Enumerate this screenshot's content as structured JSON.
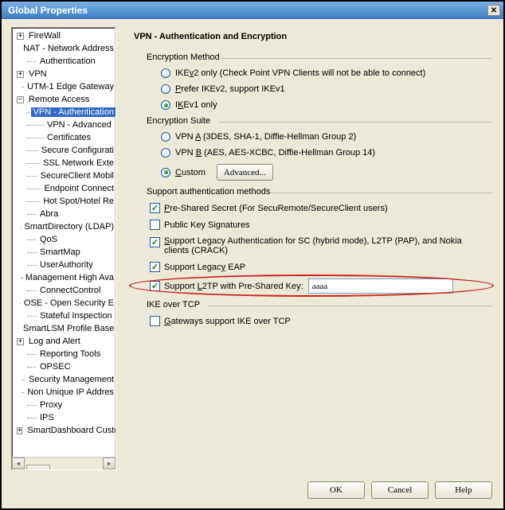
{
  "window": {
    "title": "Global Properties"
  },
  "tree": {
    "firewall": "FireWall",
    "nat": "NAT - Network Address",
    "auth": "Authentication",
    "vpn": "VPN",
    "utm": "UTM-1 Edge Gateway",
    "remote": "Remote Access",
    "vpnauth": "VPN - Authentication",
    "vpnadv": "VPN - Advanced",
    "certs": "Certificates",
    "secconf": "Secure Configurati",
    "sslnet": "SSL Network Exte",
    "scmobile": "SecureClient Mobil",
    "endpoint": "Endpoint Connect",
    "hotspot": "Hot Spot/Hotel Re",
    "abra": "Abra",
    "smartdir": "SmartDirectory (LDAP)",
    "qos": "QoS",
    "smartmap": "SmartMap",
    "userauth": "UserAuthority",
    "mgmtha": "Management High Ava",
    "conncontrol": "ConnectControl",
    "ose": "OSE - Open Security E",
    "stateful": "Stateful Inspection",
    "slsm": "SmartLSM Profile Base",
    "logalert": "Log and Alert",
    "reporting": "Reporting Tools",
    "opsec": "OPSEC",
    "secmgmt": "Security Management",
    "nonunique": "Non Unique IP Addres",
    "proxy": "Proxy",
    "ips": "IPS",
    "sdcusto": "SmartDashboard Custo"
  },
  "page": {
    "title": "VPN - Authentication and Encryption",
    "enc_method_title": "Encryption Method",
    "enc_suite_title": "Encryption Suite",
    "supp_title": "Support authentication methods",
    "ike_title": "IKE over TCP",
    "radio_ikev2only_pre": "IKE",
    "radio_ikev2only_u": "v",
    "radio_ikev2only_post": "2 only (Check Point VPN Clients will not be able to connect)",
    "radio_prefer_pre": "",
    "radio_prefer_u": "P",
    "radio_prefer_post": "refer IKEv2, support IKEv1",
    "radio_ikev1_pre": "I",
    "radio_ikev1_u": "K",
    "radio_ikev1_post": "Ev1 only",
    "radio_vpna_pre": "VPN ",
    "radio_vpna_u": "A",
    "radio_vpna_post": " (3DES, SHA-1, Diffie-Hellman Group 2)",
    "radio_vpnb_pre": "VPN ",
    "radio_vpnb_u": "B",
    "radio_vpnb_post": " (AES, AES-XCBC, Diffie-Hellman Group 14)",
    "radio_custom_u": "C",
    "radio_custom_post": "ustom",
    "btn_advanced": "Advanced...",
    "chk_pss_u": "P",
    "chk_pss_post": "re-Shared Secret (For SecuRemote/SecureClient users)",
    "chk_pks": "Public Key Signatures",
    "chk_legacy_u": "S",
    "chk_legacy_post": "upport Legacy Authentication for SC (hybrid mode), L2TP (PAP), and Nokia clients (CRACK)",
    "chk_eap_pre": "Support Legac",
    "chk_eap_u": "y",
    "chk_eap_post": " EAP",
    "chk_l2tp_pre": "Support ",
    "chk_l2tp_u": "L",
    "chk_l2tp_post": "2TP with Pre-Shared Key:",
    "l2tp_value": "aaaa",
    "chk_gw_u": "G",
    "chk_gw_post": "ateways support IKE over TCP"
  },
  "buttons": {
    "ok": "OK",
    "cancel": "Cancel",
    "help": "Help"
  }
}
